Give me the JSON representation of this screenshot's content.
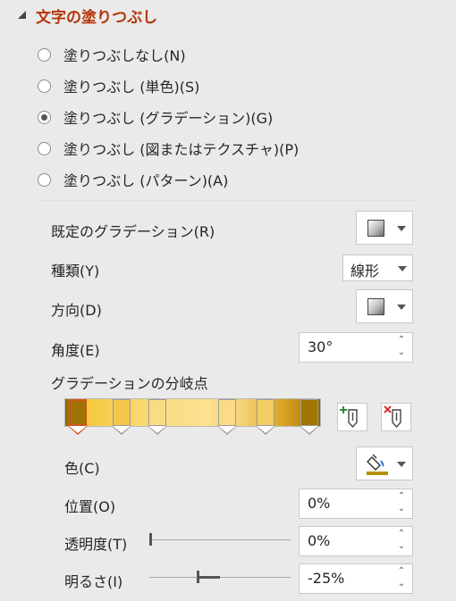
{
  "section": {
    "title": "文字の塗りつぶし"
  },
  "fill_options": [
    {
      "label": "塗りつぶしなし(N)",
      "selected": false
    },
    {
      "label": "塗りつぶし (単色)(S)",
      "selected": false
    },
    {
      "label": "塗りつぶし (グラデーション)(G)",
      "selected": true
    },
    {
      "label": "塗りつぶし (図またはテクスチャ)(P)",
      "selected": false
    },
    {
      "label": "塗りつぶし (パターン)(A)",
      "selected": false
    }
  ],
  "preset": {
    "label": "既定のグラデーション(R)"
  },
  "type": {
    "label": "種類(Y)",
    "value": "線形"
  },
  "direction": {
    "label": "方向(D)"
  },
  "angle": {
    "label": "角度(E)",
    "value": "30°"
  },
  "stops": {
    "label": "グラデーションの分岐点",
    "positions": [
      0.05,
      0.22,
      0.36,
      0.63,
      0.78,
      0.95
    ],
    "colors": [
      "#9d7303",
      "#f2c84b",
      "#fbdc86",
      "#fbdc86",
      "#f2cd62",
      "#a07503"
    ],
    "selected_index": 0
  },
  "color": {
    "label": "色(C)",
    "accent": "#b78f00"
  },
  "position": {
    "label": "位置(O)",
    "value": "0%"
  },
  "transparency": {
    "label": "透明度(T)",
    "value": "0%",
    "level": 0
  },
  "brightness": {
    "label": "明るさ(I)",
    "value": "-25%",
    "level": -0.25
  }
}
